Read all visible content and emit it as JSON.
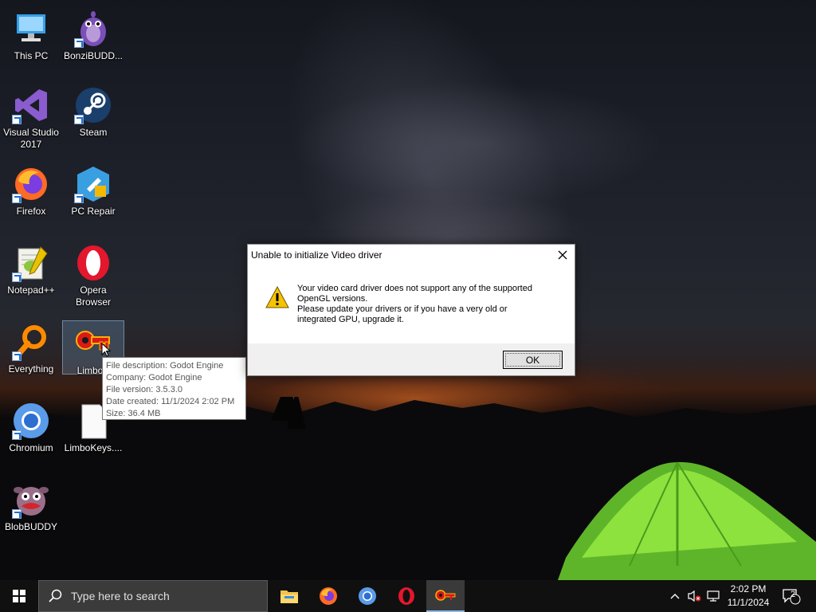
{
  "desktop_icons": [
    {
      "label": "This PC",
      "icon": "this-pc-icon"
    },
    {
      "label": "BonziBUDD...",
      "icon": "bonzibuddy-icon"
    },
    {
      "label": "Visual Studio 2017",
      "icon": "visual-studio-icon"
    },
    {
      "label": "Steam",
      "icon": "steam-icon"
    },
    {
      "label": "Firefox",
      "icon": "firefox-icon"
    },
    {
      "label": "PC Repair",
      "icon": "pc-repair-icon"
    },
    {
      "label": "Notepad++",
      "icon": "notepadpp-icon"
    },
    {
      "label": "Opera Browser",
      "icon": "opera-icon"
    },
    {
      "label": "Everything",
      "icon": "everything-icon"
    },
    {
      "label": "LimboK",
      "icon": "limbokeys-icon"
    },
    {
      "label": "Chromium",
      "icon": "chromium-icon"
    },
    {
      "label": "LimboKeys....",
      "icon": "file-icon"
    },
    {
      "label": "BlobBUDDY",
      "icon": "blobbuddy-icon"
    }
  ],
  "dialog": {
    "title": "Unable to initialize Video driver",
    "message_lines": [
      "Your video card driver does not support any of the supported",
      "OpenGL versions.",
      "Please update your drivers or if you have a very old or",
      "integrated GPU, upgrade it."
    ],
    "ok_label": "OK"
  },
  "tooltip": {
    "lines": [
      "File description: Godot Engine",
      "Company: Godot Engine",
      "File version: 3.5.3.0",
      "Date created: 11/1/2024 2:02 PM",
      "Size: 36.4 MB"
    ]
  },
  "taskbar": {
    "search_placeholder": "Type here to search",
    "apps": [
      "file-explorer-icon",
      "firefox-icon",
      "chromium-icon",
      "opera-icon",
      "limbokeys-icon"
    ],
    "clock_time": "2:02 PM",
    "clock_date": "11/1/2024",
    "notification_count": "2"
  },
  "colors": {
    "taskbar": "#101010",
    "search_box": "#3b3b3b",
    "dialog_footer": "#f0f0f0",
    "tent_green": "#7fd23a"
  }
}
